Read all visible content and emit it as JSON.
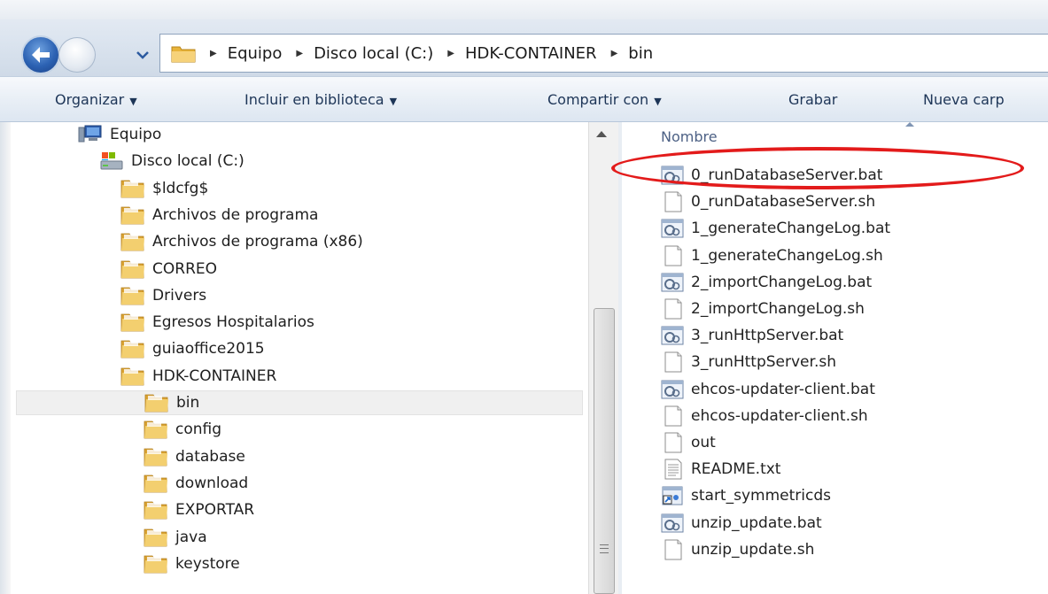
{
  "address_bar": {
    "breadcrumbs": [
      "Equipo",
      "Disco local (C:)",
      "HDK-CONTAINER",
      "bin"
    ]
  },
  "toolbar": {
    "organize": "Organizar",
    "include_library": "Incluir en biblioteca",
    "share": "Compartir con",
    "burn": "Grabar",
    "new_folder": "Nueva carp"
  },
  "nav_tree": {
    "computer": "Equipo",
    "local_disk": "Disco local (C:)",
    "folders": [
      "$ldcfg$",
      "Archivos de programa",
      "Archivos de programa (x86)",
      "CORREO",
      "Drivers",
      "Egresos Hospitalarios",
      "guiaoffice2015",
      "HDK-CONTAINER"
    ],
    "subfolders": [
      "bin",
      "config",
      "database",
      "download",
      "EXPORTAR",
      "java",
      "keystore"
    ],
    "selected": "bin"
  },
  "file_list": {
    "column_name": "Nombre",
    "files": [
      {
        "name": "0_runDatabaseServer.bat",
        "icon": "batch-file-icon"
      },
      {
        "name": "0_runDatabaseServer.sh",
        "icon": "blank-file-icon"
      },
      {
        "name": "1_generateChangeLog.bat",
        "icon": "batch-file-icon"
      },
      {
        "name": "1_generateChangeLog.sh",
        "icon": "blank-file-icon"
      },
      {
        "name": "2_importChangeLog.bat",
        "icon": "batch-file-icon"
      },
      {
        "name": "2_importChangeLog.sh",
        "icon": "blank-file-icon"
      },
      {
        "name": "3_runHttpServer.bat",
        "icon": "batch-file-icon"
      },
      {
        "name": "3_runHttpServer.sh",
        "icon": "blank-file-icon"
      },
      {
        "name": "ehcos-updater-client.bat",
        "icon": "batch-file-icon"
      },
      {
        "name": "ehcos-updater-client.sh",
        "icon": "blank-file-icon"
      },
      {
        "name": "out",
        "icon": "blank-file-icon"
      },
      {
        "name": "README.txt",
        "icon": "text-file-icon"
      },
      {
        "name": "start_symmetricds",
        "icon": "shortcut-icon"
      },
      {
        "name": "unzip_update.bat",
        "icon": "batch-file-icon"
      },
      {
        "name": "unzip_update.sh",
        "icon": "blank-file-icon"
      }
    ]
  },
  "colors": {
    "highlight_ellipse": "#e31b1b",
    "folder": "#e8b43a",
    "selection": "#f0f0f0"
  }
}
